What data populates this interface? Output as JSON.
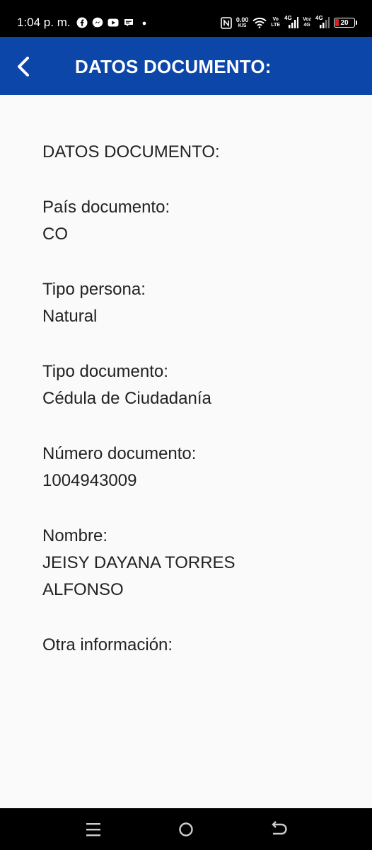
{
  "status_bar": {
    "time": "1:04 p. m.",
    "network_speed_value": "0.00",
    "network_speed_unit": "K/S",
    "volte_top": "Vo",
    "volte_bottom": "LTE",
    "signal1_label": "4G",
    "voz_top": "Voz",
    "voz_bottom": "4G",
    "signal2_label": "4G",
    "battery": "20"
  },
  "app_bar": {
    "back_icon": "chevron-left-icon",
    "title": "DATOS DOCUMENTO:"
  },
  "content": {
    "heading": "DATOS DOCUMENTO:",
    "fields": [
      {
        "label": "País documento:",
        "value": "CO"
      },
      {
        "label": "Tipo persona:",
        "value": "Natural"
      },
      {
        "label": "Tipo documento:",
        "value": "Cédula de Ciudadanía"
      },
      {
        "label": "Número documento:",
        "value": "1004943009"
      },
      {
        "label": "Nombre:",
        "value_line1": "JEISY DAYANA TORRES",
        "value_line2": "ALFONSO"
      }
    ],
    "other_info_label": "Otra información:"
  },
  "nav_bar": {
    "icons": [
      "menu-icon",
      "home-icon",
      "back-icon"
    ]
  },
  "colors": {
    "app_bar": "#0b46a8",
    "background": "#fafafa",
    "text": "#222222",
    "battery_low": "#e02020"
  }
}
